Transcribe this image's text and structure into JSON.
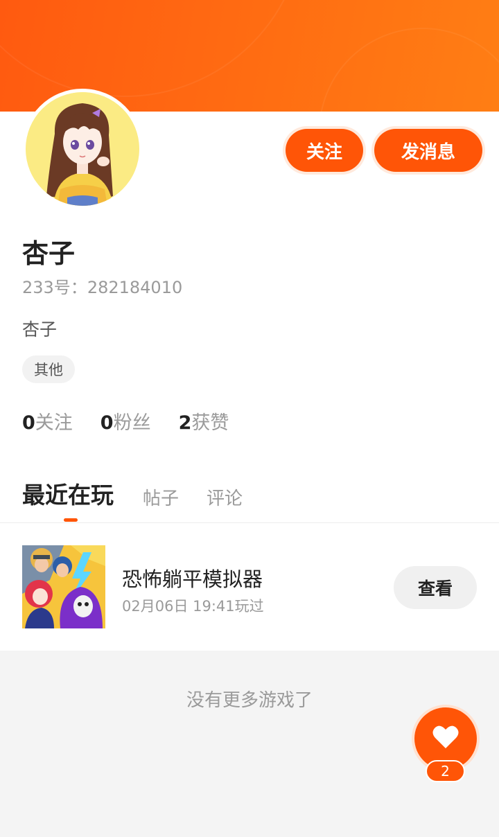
{
  "colors": {
    "accent": "#ff5507",
    "header_start": "#ff5a10",
    "header_end": "#ff7e14"
  },
  "header": {
    "follow_label": "关注",
    "message_label": "发消息"
  },
  "profile": {
    "name": "杏子",
    "id_label": "233号：",
    "id_value": "282184010",
    "bio": "杏子",
    "tag": "其他",
    "stats": [
      {
        "count": "0",
        "label": "关注"
      },
      {
        "count": "0",
        "label": "粉丝"
      },
      {
        "count": "2",
        "label": "获赞"
      }
    ]
  },
  "tabs": [
    {
      "label": "最近在玩",
      "active": true
    },
    {
      "label": "帖子",
      "active": false
    },
    {
      "label": "评论",
      "active": false
    }
  ],
  "games": [
    {
      "name": "恐怖躺平模拟器",
      "played": "02月06日 19:41玩过",
      "action_label": "查看",
      "icon": "game-cover-image"
    }
  ],
  "list_footer": "没有更多游戏了",
  "like_button": {
    "icon": "heart-icon",
    "count": "2"
  }
}
